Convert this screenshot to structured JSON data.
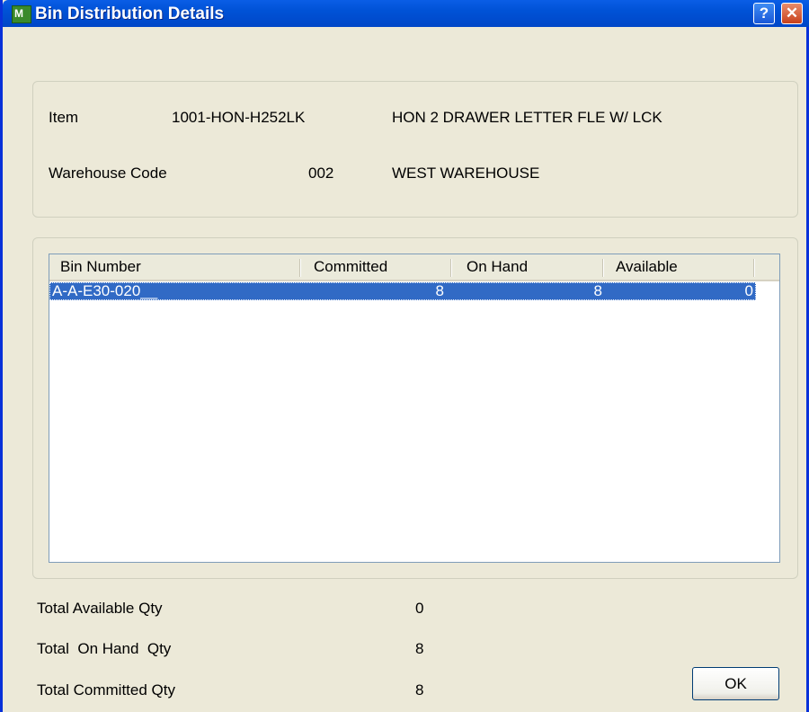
{
  "window": {
    "title": "Bin Distribution Details",
    "icon_glyph": "M",
    "help_glyph": "?",
    "close_glyph": "✕"
  },
  "item_info": {
    "item_label": "Item",
    "item_code": "1001-HON-H252LK",
    "item_description": "HON 2 DRAWER LETTER FLE W/ LCK",
    "warehouse_label": "Warehouse Code",
    "warehouse_code": "002",
    "warehouse_name": "WEST WAREHOUSE"
  },
  "bins_table": {
    "columns": [
      "Bin Number",
      "Committed",
      "On Hand",
      "Available"
    ],
    "rows": [
      {
        "bin_number": "A-A-E30-020__",
        "committed": "8",
        "on_hand": "8",
        "available": "0"
      }
    ]
  },
  "totals": {
    "available_label": "Total Available Qty",
    "available_value": "0",
    "on_hand_label": "Total  On Hand  Qty",
    "on_hand_value": "8",
    "committed_label": "Total Committed Qty",
    "committed_value": "8"
  },
  "buttons": {
    "ok_label": "OK"
  },
  "colors": {
    "titlebar": "#0052d6",
    "selection": "#316ac5",
    "dialog_bg": "#ece9d8"
  }
}
